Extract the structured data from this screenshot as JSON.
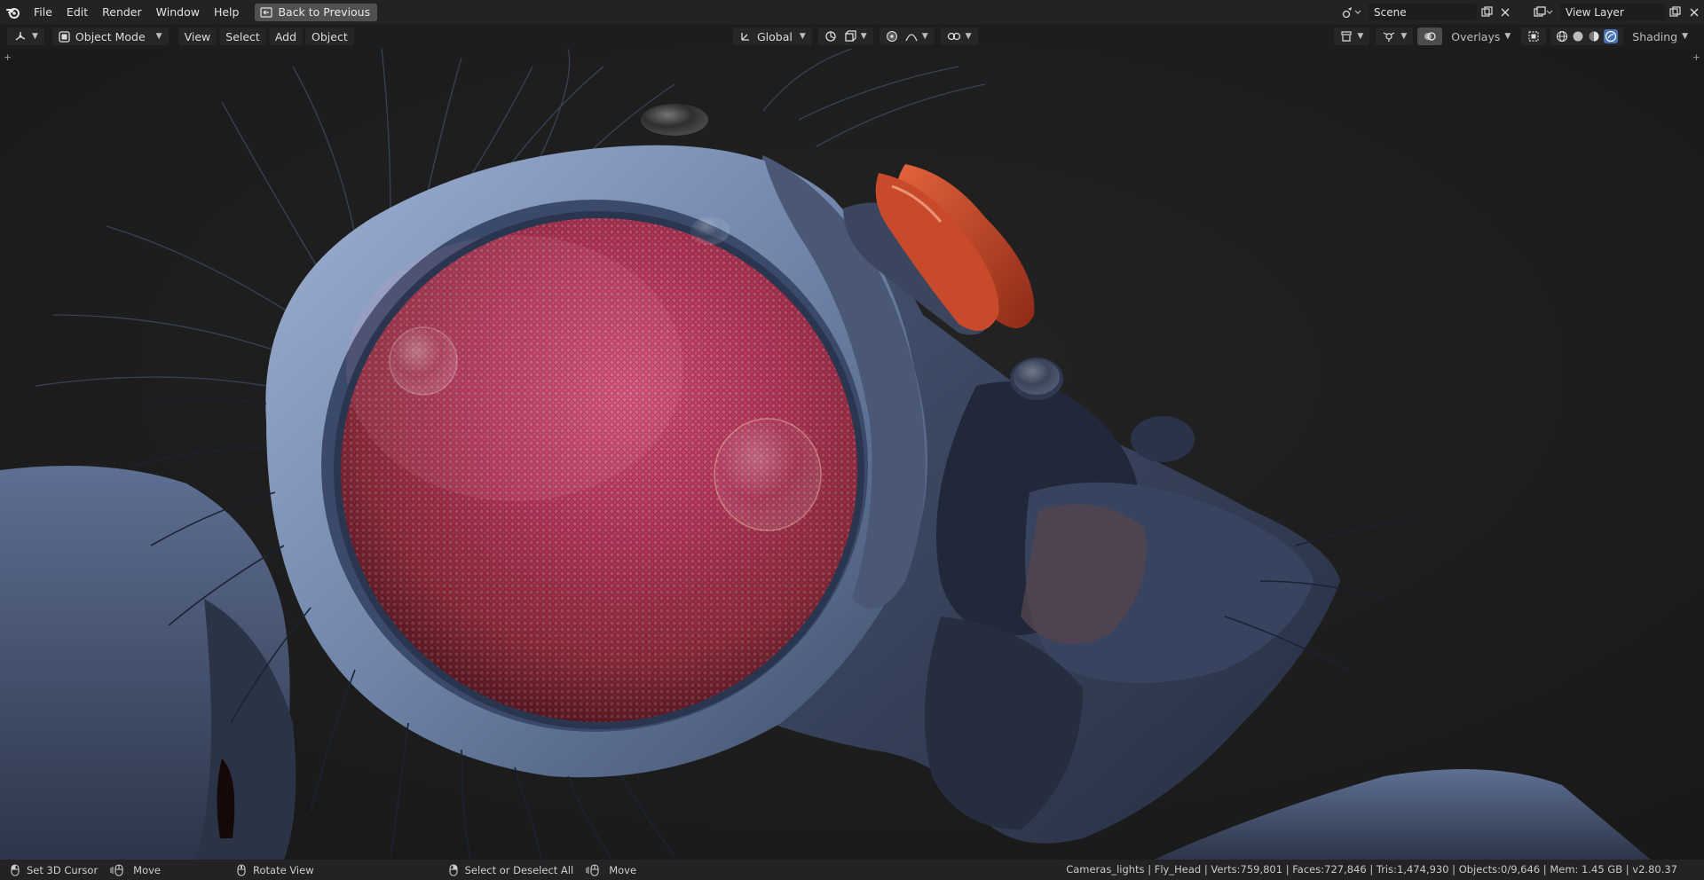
{
  "top_menu": {
    "items": [
      "File",
      "Edit",
      "Render",
      "Window",
      "Help"
    ],
    "back_button": "Back to Previous",
    "scene": "Scene",
    "view_layer": "View Layer"
  },
  "header": {
    "mode": "Object Mode",
    "menus": [
      "View",
      "Select",
      "Add",
      "Object"
    ],
    "orientation": "Global",
    "overlays": "Overlays",
    "shading": "Shading"
  },
  "viewport": {
    "subject": "fly-head-3d-render",
    "colors": {
      "background": "#1c1c1c",
      "eye": "#b5365a",
      "body": "#4b5a78",
      "antenna": "#d0512e"
    }
  },
  "status_bar": {
    "actions": [
      {
        "label": "Set 3D Cursor",
        "icon": "mouse-left-icon"
      },
      {
        "label": "Move",
        "icon": "mouse-drag-icon"
      },
      {
        "label": "Rotate View",
        "icon": "mouse-middle-icon"
      },
      {
        "label": "Select or Deselect All",
        "icon": "mouse-right-icon"
      },
      {
        "label": "Move",
        "icon": "mouse-drag-icon"
      }
    ],
    "stats": "Cameras_lights | Fly_Head | Verts:759,801 | Faces:727,846 | Tris:1,474,930 | Objects:0/9,646 | Mem: 1.45 GB | v2.80.37"
  }
}
